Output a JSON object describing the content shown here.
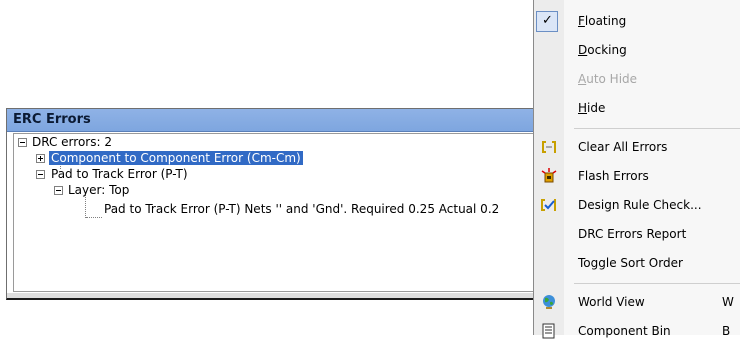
{
  "panel": {
    "title": "ERC Errors",
    "tree": {
      "root": "DRC errors: 2",
      "item1": "Component to Component Error (Cm-Cm)",
      "item2": "Pad to Track Error (P-T)",
      "layer": "Layer: Top",
      "detail": "Pad to Track Error (P-T) Nets '' and 'Gnd'. Required 0.25 Actual 0.2"
    }
  },
  "menu": {
    "floating": {
      "first": "F",
      "rest": "loating",
      "checked": true
    },
    "docking": {
      "first": "D",
      "rest": "ocking"
    },
    "auto_hide": {
      "first": "A",
      "rest": "uto Hide",
      "disabled": true
    },
    "hide": {
      "first": "H",
      "rest": "ide"
    },
    "clear_all_errors": "Clear All Errors",
    "flash_errors": "Flash Errors",
    "design_rule_check": "Design Rule Check...",
    "drc_errors_report": "DRC Errors Report",
    "toggle_sort_order": "Toggle Sort Order",
    "world_view": {
      "label": "World View",
      "key": "W"
    },
    "component_bin": {
      "label": "Component Bin",
      "key": "B"
    }
  },
  "colors": {
    "title_bar": "#8fb2e6",
    "selection": "#316ac5",
    "menu_bg": "#f7f7f7"
  }
}
